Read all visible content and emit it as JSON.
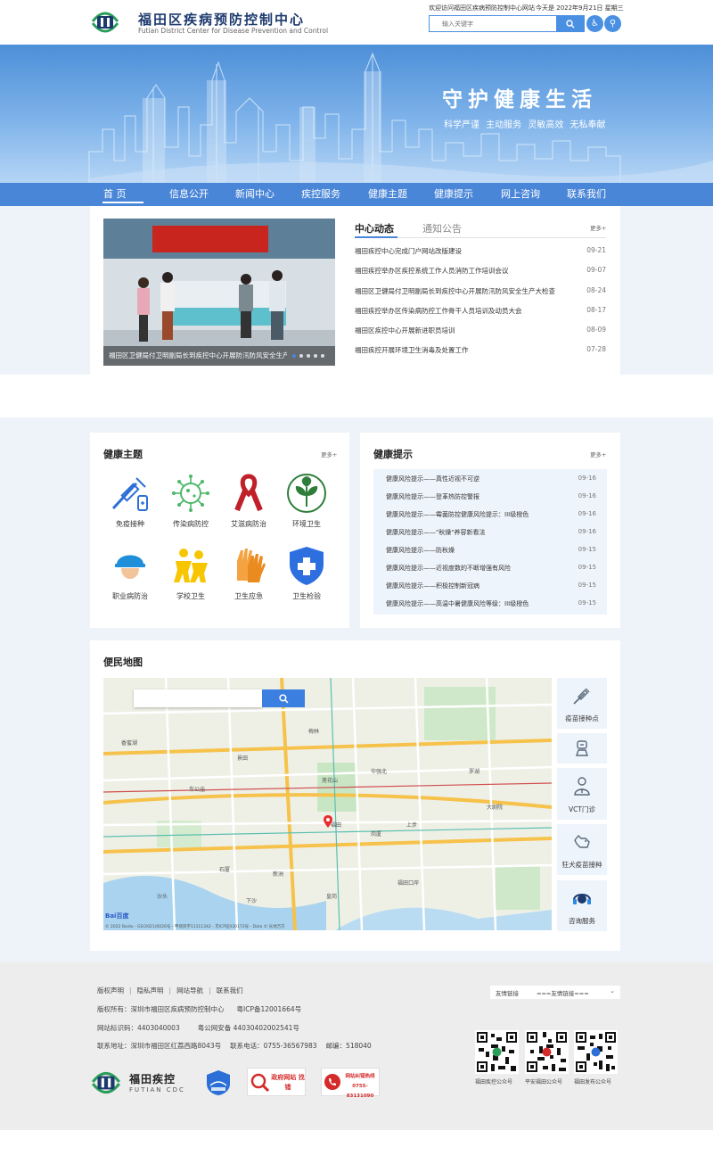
{
  "header": {
    "site_name_cn": "福田区疾病预防控制中心",
    "site_name_en": "Futian District Center for Disease Prevention and Control",
    "welcome": "欢迎访问福田区疾病预防控制中心网站",
    "today_label": "今天是",
    "date": "2022年9月21日 星期三",
    "search_placeholder": "输入关键字",
    "accessibility_icon": "wheelchair-icon",
    "elder_icon": "elder-mode-icon"
  },
  "banner": {
    "slogan": "守护健康生活",
    "subtitle": "科学严谨 主动服务 灵敏高效 无私奉献"
  },
  "nav": {
    "items": [
      "首 页",
      "信息公开",
      "新闻中心",
      "疾控服务",
      "健康主题",
      "健康提示",
      "网上咨询",
      "联系我们"
    ]
  },
  "news": {
    "tab_active": "中心动态",
    "tab_inactive": "通知公告",
    "more": "更多+",
    "slide_caption": "福田区卫健局付卫明副局长到疾控中心开展防汛防风安全生产",
    "items": [
      {
        "title": "福田疾控中心完成门户网站改版建设",
        "date": "09-21"
      },
      {
        "title": "福田疾控举办区疾控系统工作人员消防工作培训会议",
        "date": "09-07"
      },
      {
        "title": "福田区卫健局付卫明副局长到疾控中心开展防汛防风安全生产大检查",
        "date": "08-24"
      },
      {
        "title": "福田疾控举办区传染病防控工作骨干人员培训及动员大会",
        "date": "08-17"
      },
      {
        "title": "福田区疾控中心开展新进职员培训",
        "date": "08-09"
      },
      {
        "title": "福田疾控开展环境卫生消毒及处置工作",
        "date": "07-28"
      }
    ]
  },
  "health_topics": {
    "title": "健康主题",
    "more": "更多+",
    "items": [
      {
        "label": "免疫接种",
        "icon": "vaccine-icon"
      },
      {
        "label": "传染病防控",
        "icon": "virus-icon"
      },
      {
        "label": "艾滋病防治",
        "icon": "red-ribbon-icon"
      },
      {
        "label": "环境卫生",
        "icon": "leaf-icon"
      },
      {
        "label": "职业病防治",
        "icon": "helmet-icon"
      },
      {
        "label": "学校卫生",
        "icon": "students-icon"
      },
      {
        "label": "卫生应急",
        "icon": "gloves-icon"
      },
      {
        "label": "卫生检验",
        "icon": "shield-cross-icon"
      }
    ]
  },
  "health_tips": {
    "title": "健康提示",
    "more": "更多+",
    "items": [
      {
        "title": "健康风险提示——真性近视不可逆",
        "date": "09-16"
      },
      {
        "title": "健康风险提示——登革热防控警报",
        "date": "09-16"
      },
      {
        "title": "健康风险提示——霉菌防控健康风险提示：III级橙色",
        "date": "09-16"
      },
      {
        "title": "健康风险提示——\"秋燥\"养容新看法",
        "date": "09-16"
      },
      {
        "title": "健康风险提示——防秋燥",
        "date": "09-15"
      },
      {
        "title": "健康风险提示——近视度数的不断增强有风险",
        "date": "09-15"
      },
      {
        "title": "健康风险提示——积极控制新冠病",
        "date": "09-15"
      },
      {
        "title": "健康风险提示——高温中暑健康风险等级：III级橙色",
        "date": "09-15"
      }
    ]
  },
  "map": {
    "title": "便民地图",
    "copyright": "© 2022 Baidu - GS(2021)6026号 - 甲测资字11111342 - 京ICP证030173号 - Data © 长地万方",
    "baidu_logo": "Bai百度",
    "labels": [
      "香蜜湖",
      "福田",
      "新洲",
      "车公庙",
      "华强北",
      "梅林",
      "景田",
      "莲花山",
      "福田口岸",
      "皇岗",
      "石厦",
      "沙头",
      "下沙",
      "上步",
      "岗厦",
      "罗湖",
      "大剧院"
    ],
    "side_buttons": [
      {
        "label": "疫苗接种点",
        "icon": "syringe-icon"
      },
      {
        "label": "",
        "icon": "clinic-icon"
      },
      {
        "label": "VCT门诊",
        "icon": "doctor-icon"
      },
      {
        "label": "狂犬疫苗接种",
        "icon": "dog-icon"
      },
      {
        "label": "咨询服务",
        "icon": "headset-icon"
      }
    ]
  },
  "footer": {
    "links": [
      "版权声明",
      "隐私声明",
      "网站导航",
      "联系我们"
    ],
    "copyright": "版权所有：深圳市福田区疾病预防控制中心",
    "icp": "粤ICP备12001664号",
    "site_code_label": "网站标识码：",
    "site_code": "4403040003",
    "police": "粤公网安备 44030402002541号",
    "address": "联系地址：深圳市福田区红荔西路8043号",
    "phone": "联系电话：0755-36567983",
    "postcode": "邮编：518040",
    "friend_label": "友情链接",
    "friend_select": "===友情链接===",
    "brand_cn": "福田疾控",
    "brand_en": "FUTIAN CDC",
    "badge_gov_error": "政府网站 找错",
    "badge_report": "网站纠错热线 0755-83131090",
    "qr_labels": [
      "福田疾控公众号",
      "平安福田公众号",
      "福田发布公众号"
    ]
  },
  "colors": {
    "primary": "#4a86d8",
    "accent": "#3b7fe0",
    "ribbon": "#c0202a"
  }
}
